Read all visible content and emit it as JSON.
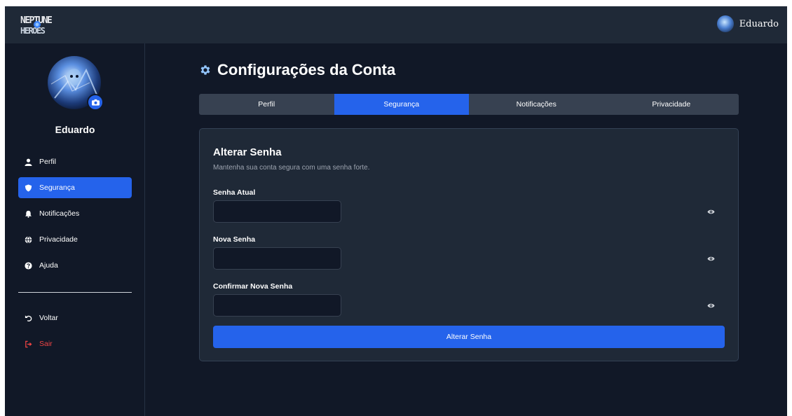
{
  "header": {
    "logo_text": "NEPTUNE HEROES",
    "username": "Eduardo"
  },
  "sidebar": {
    "username": "Eduardo",
    "items": [
      {
        "label": "Perfil",
        "icon": "user-icon",
        "active": false
      },
      {
        "label": "Segurança",
        "icon": "shield-icon",
        "active": true
      },
      {
        "label": "Notificações",
        "icon": "bell-icon",
        "active": false
      },
      {
        "label": "Privacidade",
        "icon": "globe-icon",
        "active": false
      },
      {
        "label": "Ajuda",
        "icon": "question-icon",
        "active": false
      }
    ],
    "bottom_items": [
      {
        "label": "Voltar",
        "icon": "undo-icon"
      },
      {
        "label": "Sair",
        "icon": "sign-out-icon"
      }
    ]
  },
  "main": {
    "title": "Configurações da Conta",
    "title_icon": "gear-icon",
    "tabs": [
      {
        "label": "Perfil",
        "active": false
      },
      {
        "label": "Segurança",
        "active": true
      },
      {
        "label": "Notificações",
        "active": false
      },
      {
        "label": "Privacidade",
        "active": false
      }
    ],
    "card": {
      "title": "Alterar Senha",
      "subtitle": "Mantenha sua conta segura com uma senha forte.",
      "fields": [
        {
          "label": "Senha Atual",
          "value": ""
        },
        {
          "label": "Nova Senha",
          "value": ""
        },
        {
          "label": "Confirmar Nova Senha",
          "value": ""
        }
      ],
      "submit_label": "Alterar Senha"
    }
  },
  "colors": {
    "background": "#111827",
    "panel": "#1f2937",
    "accent": "#2563eb",
    "danger": "#ef4444",
    "muted_text": "#9ca3af"
  }
}
